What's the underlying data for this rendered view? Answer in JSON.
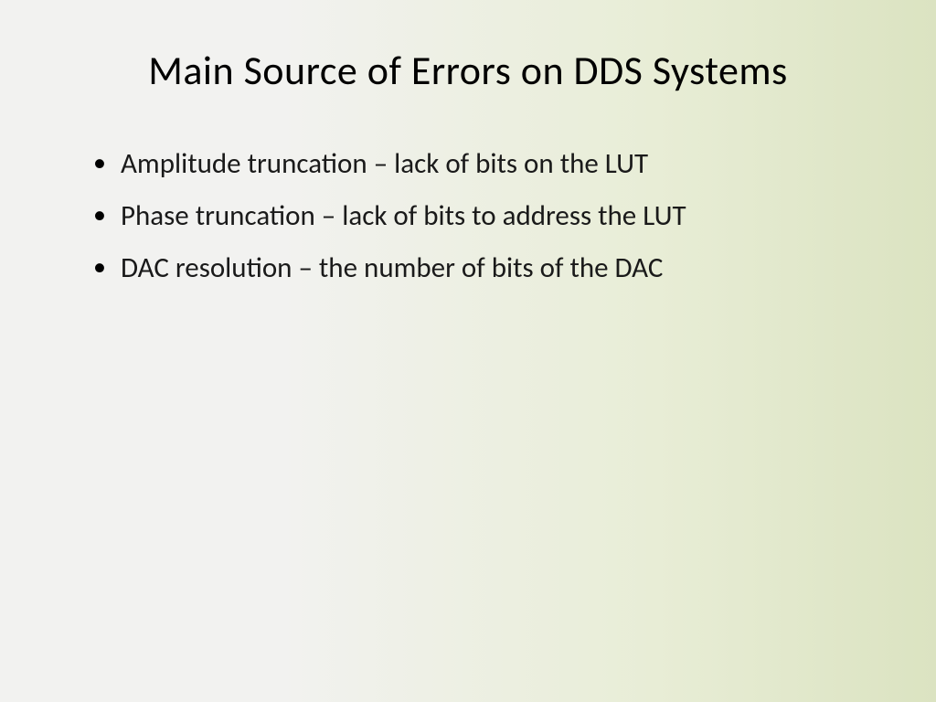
{
  "slide": {
    "title": "Main Source of Errors on DDS Systems",
    "bullets": [
      "Amplitude truncation – lack of bits on the LUT",
      "Phase truncation – lack of bits to address the LUT",
      "DAC resolution – the number of bits of the DAC"
    ]
  }
}
